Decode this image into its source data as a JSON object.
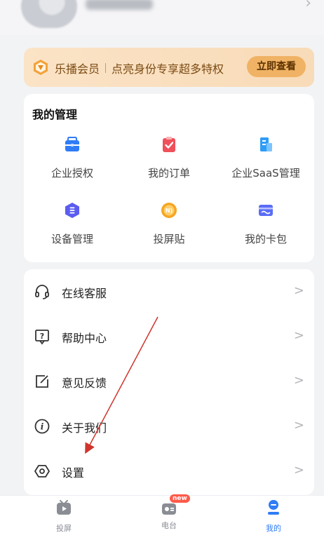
{
  "vip": {
    "title": "乐播会员",
    "subtitle": "点亮身份专享超多特权",
    "cta": "立即查看"
  },
  "management": {
    "title": "我的管理",
    "items": [
      {
        "label": "企业授权",
        "icon": "briefcase-icon",
        "color": "#2f7cf6"
      },
      {
        "label": "我的订单",
        "icon": "clipboard-check-icon",
        "color": "#f0505a"
      },
      {
        "label": "企业SaaS管理",
        "icon": "building-icon",
        "color": "#2f9cf6"
      },
      {
        "label": "设备管理",
        "icon": "hexagon-device-icon",
        "color": "#5b5cf0"
      },
      {
        "label": "投屏贴",
        "icon": "nfc-sticker-icon",
        "color": "#f6a623"
      },
      {
        "label": "我的卡包",
        "icon": "card-wallet-icon",
        "color": "#5a6cf6"
      }
    ]
  },
  "menu": {
    "items": [
      {
        "label": "在线客服",
        "icon": "headset-icon"
      },
      {
        "label": "帮助中心",
        "icon": "help-icon"
      },
      {
        "label": "意见反馈",
        "icon": "feedback-icon"
      },
      {
        "label": "关于我们",
        "icon": "info-icon"
      },
      {
        "label": "设置",
        "icon": "settings-icon"
      }
    ],
    "chevron": ">"
  },
  "tabbar": {
    "tabs": [
      {
        "label": "投屏",
        "icon": "cast-tv-icon"
      },
      {
        "label": "电台",
        "icon": "radio-icon",
        "badge": "new"
      },
      {
        "label": "我的",
        "icon": "user-icon",
        "active": true
      }
    ]
  },
  "colors": {
    "accent": "#2f7cf6",
    "vip_gold": "#f0b264",
    "annotation_arrow": "#d0342c"
  }
}
